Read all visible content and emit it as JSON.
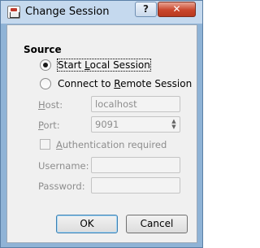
{
  "window": {
    "title": "Change Session",
    "help_glyph": "?",
    "close_glyph": "✕",
    "app_icon": "session-app-icon"
  },
  "source": {
    "heading": "Source",
    "options": [
      {
        "label": "Start Local Session",
        "accel": "L",
        "selected": true
      },
      {
        "label": "Connect to Remote Session",
        "accel": "R",
        "selected": false
      }
    ]
  },
  "fields": {
    "host": {
      "label": "Host:",
      "accel": "H",
      "value": "localhost",
      "enabled": false
    },
    "port": {
      "label": "Port:",
      "accel": "P",
      "value": "9091",
      "enabled": false
    },
    "auth": {
      "label": "Authentication required",
      "accel": "A",
      "checked": false,
      "enabled": false
    },
    "username": {
      "label": "Username:",
      "value": "",
      "enabled": false
    },
    "password": {
      "label": "Password:",
      "value": "",
      "enabled": false
    }
  },
  "buttons": {
    "ok": "OK",
    "cancel": "Cancel"
  }
}
